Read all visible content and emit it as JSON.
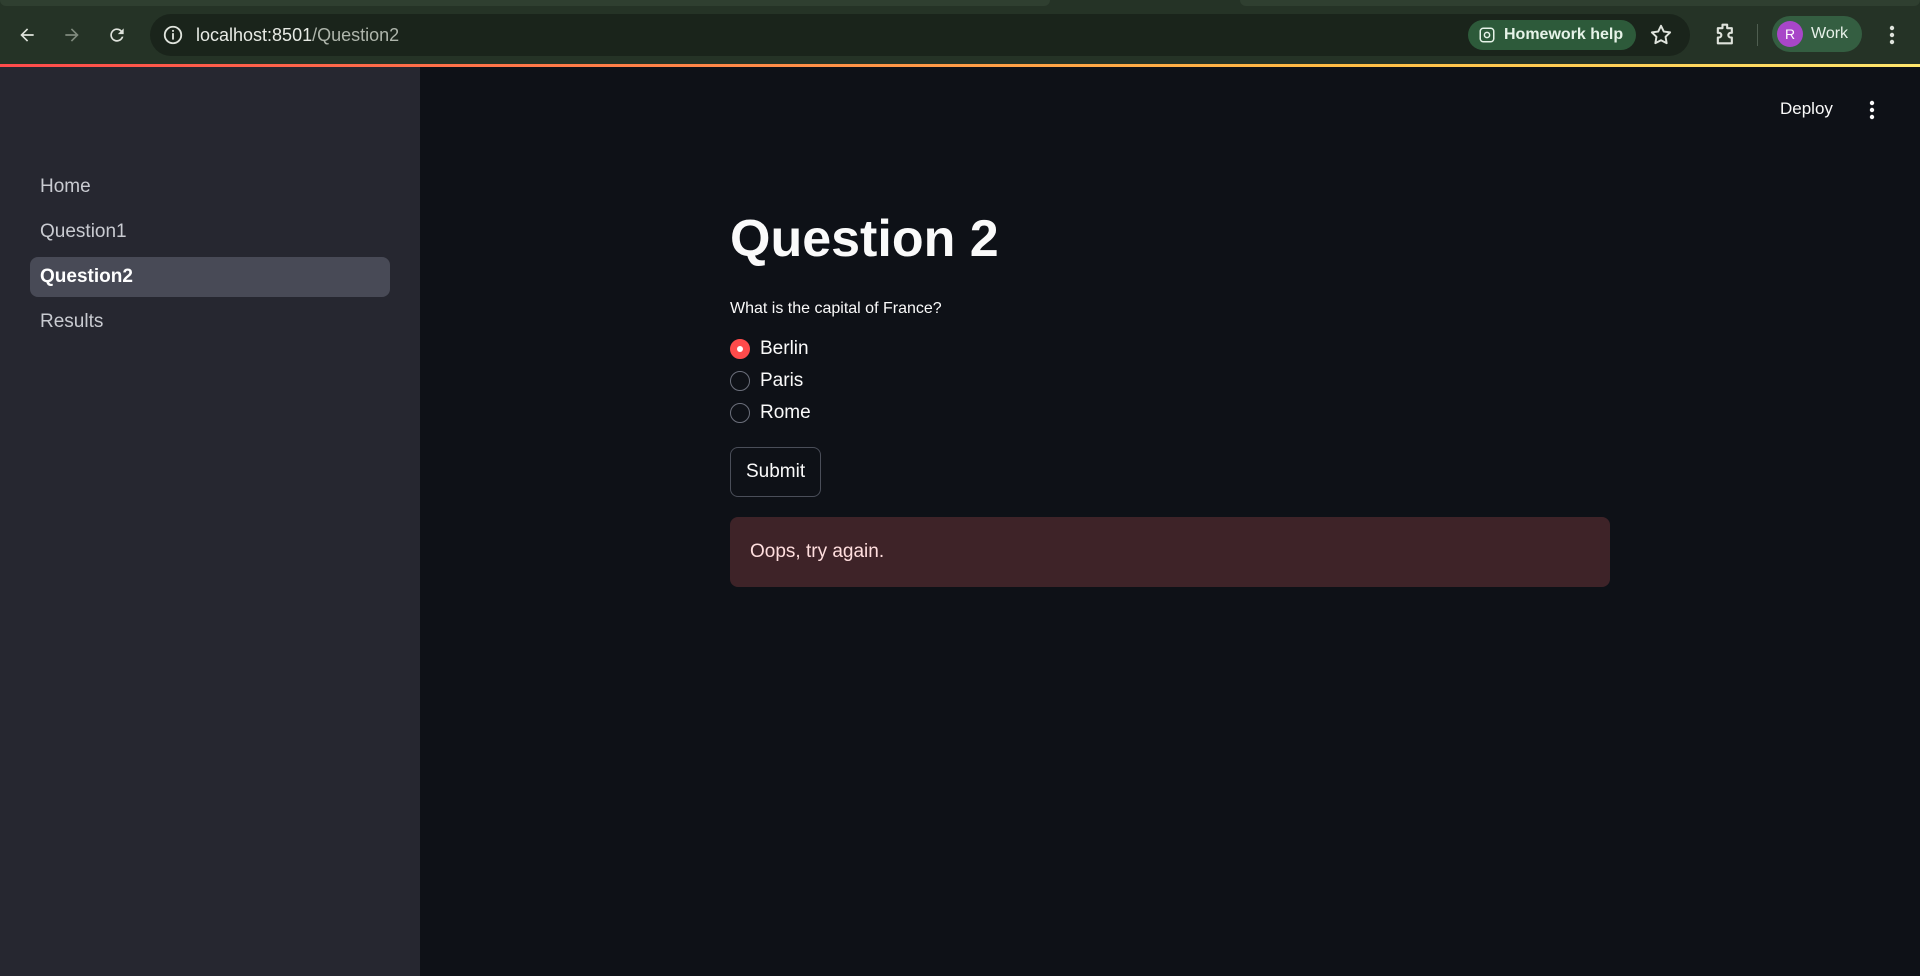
{
  "browser": {
    "url_host": "localhost:8501",
    "url_path": "/Question2",
    "homework_chip": "Homework help",
    "profile_initial": "R",
    "profile_name": "Work",
    "icons": [
      "back-icon",
      "forward-icon",
      "reload-icon",
      "info-icon",
      "lens-icon",
      "star-icon",
      "extensions-icon",
      "menu-icon"
    ]
  },
  "sidebar": {
    "items": [
      {
        "label": "Home",
        "active": false
      },
      {
        "label": "Question1",
        "active": false
      },
      {
        "label": "Question2",
        "active": true
      },
      {
        "label": "Results",
        "active": false
      }
    ]
  },
  "toolbar": {
    "deploy_label": "Deploy"
  },
  "main": {
    "title": "Question 2",
    "question": "What is the capital of France?",
    "options": [
      {
        "label": "Berlin",
        "selected": true
      },
      {
        "label": "Paris",
        "selected": false
      },
      {
        "label": "Rome",
        "selected": false
      }
    ],
    "submit_label": "Submit",
    "alert_text": "Oops, try again."
  },
  "colors": {
    "accent": "#ff4b4b",
    "sidebar_bg": "#262730",
    "main_bg": "#0e1117",
    "error_bg": "#3e2328",
    "chrome_bg": "#253326"
  }
}
